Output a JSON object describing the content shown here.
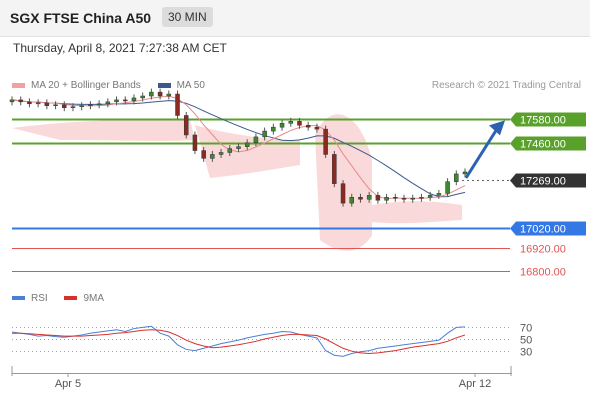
{
  "header": {
    "title": "SGX FTSE China A50",
    "interval": "30 MIN",
    "datetime": "Thursday, April 8, 2021 7:27:38 AM CET"
  },
  "legend": {
    "bollinger_label": "MA 20 + Bollinger Bands",
    "ma50_label": "MA 50",
    "credit": "Research © 2021 Trading Central"
  },
  "rsi_legend": {
    "rsi_label": "RSI",
    "ma9_label": "9MA"
  },
  "colors": {
    "resistance": "#5aa12b",
    "support": "#3478e6",
    "target": "#e05555",
    "ma50": "#3a5a8c",
    "band": "#f7c9c9",
    "ma20": "#e88a8a",
    "current": "#333333",
    "arrow": "#2b63b0",
    "rsi": "#4a7fd6",
    "rsi_ma": "#d9302c"
  },
  "chart_data": [
    {
      "type": "candlestick",
      "title": "SGX FTSE China A50",
      "interval": "30 MIN",
      "x_tick_labels": [
        "Apr 5",
        "Apr 12"
      ],
      "ylim": [
        16740,
        17700
      ],
      "levels": [
        {
          "value": 17580.0,
          "label": "17580.00",
          "kind": "resistance"
        },
        {
          "value": 17460.0,
          "label": "17460.00",
          "kind": "resistance"
        },
        {
          "value": 17269.0,
          "label": "17269.00",
          "kind": "current"
        },
        {
          "value": 17020.0,
          "label": "17020.00",
          "kind": "support"
        },
        {
          "value": 16920.0,
          "label": "16920.00",
          "kind": "target"
        },
        {
          "value": 16800.0,
          "label": "16800.00",
          "kind": "target"
        }
      ],
      "close_series": [
        17680,
        17670,
        17660,
        17665,
        17650,
        17655,
        17640,
        17645,
        17650,
        17655,
        17660,
        17670,
        17680,
        17675,
        17690,
        17700,
        17720,
        17700,
        17710,
        17600,
        17500,
        17420,
        17380,
        17400,
        17410,
        17430,
        17440,
        17460,
        17490,
        17520,
        17540,
        17560,
        17570,
        17550,
        17540,
        17530,
        17400,
        17250,
        17150,
        17180,
        17170,
        17190,
        17165,
        17180,
        17175,
        17170,
        17175,
        17180,
        17190,
        17200,
        17260,
        17300,
        17310
      ],
      "annotations": [
        "Arrow from current price toward 17580.00"
      ]
    },
    {
      "type": "line",
      "title": "RSI",
      "series": [
        {
          "name": "RSI",
          "values": [
            62,
            60,
            58,
            55,
            56,
            54,
            53,
            55,
            57,
            60,
            62,
            64,
            66,
            63,
            68,
            70,
            72,
            60,
            55,
            40,
            32,
            30,
            34,
            38,
            42,
            45,
            48,
            52,
            55,
            58,
            60,
            63,
            62,
            58,
            55,
            52,
            30,
            22,
            20,
            25,
            28,
            30,
            34,
            36,
            38,
            40,
            42,
            44,
            46,
            48,
            60,
            70,
            71
          ]
        },
        {
          "name": "9MA",
          "values": [
            60,
            60,
            59,
            58,
            57,
            56,
            55,
            55,
            55,
            56,
            57,
            58,
            60,
            61,
            63,
            65,
            66,
            65,
            62,
            56,
            48,
            42,
            38,
            35,
            36,
            38,
            40,
            43,
            46,
            50,
            53,
            56,
            58,
            58,
            57,
            56,
            50,
            42,
            34,
            29,
            26,
            25,
            26,
            28,
            30,
            33,
            36,
            38,
            40,
            42,
            46,
            52,
            57
          ]
        }
      ],
      "y_tick_labels": [
        "70",
        "50",
        "30"
      ],
      "ylim": [
        0,
        100
      ]
    }
  ]
}
